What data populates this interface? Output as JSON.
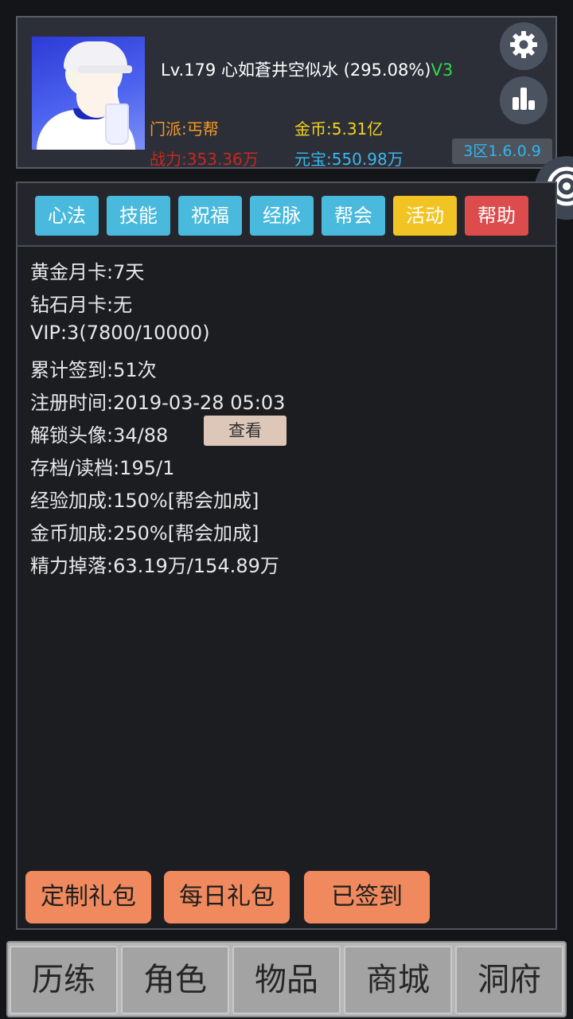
{
  "header": {
    "level_text": "Lv.179",
    "player_name": "心如蒼井空似水",
    "progress": "(295.08%)",
    "vip_tag": "V3",
    "sect": "门派:丐帮",
    "coins": "金币:5.31亿",
    "power": "战力:353.36万",
    "ingots": "元宝:550.98万",
    "version": "3区1.6.0.9",
    "icons": {
      "settings": "gear-icon",
      "stats": "bar-chart-icon",
      "side": "spiral-icon"
    }
  },
  "tabs": [
    {
      "label": "心法",
      "color": "#49b9dd"
    },
    {
      "label": "技能",
      "color": "#49b9dd"
    },
    {
      "label": "祝福",
      "color": "#49b9dd"
    },
    {
      "label": "经脉",
      "color": "#49b9dd"
    },
    {
      "label": "帮会",
      "color": "#49b9dd"
    },
    {
      "label": "活动",
      "color": "#f1c423"
    },
    {
      "label": "帮助",
      "color": "#dd4c4c"
    }
  ],
  "info": [
    "黄金月卡:7天",
    "钻石月卡:无",
    "VIP:3(7800/10000)",
    "累计签到:51次",
    "注册时间:2019-03-28 05:03",
    "解锁头像:34/88",
    "存档/读档:195/1",
    "经验加成:150%[帮会加成]",
    "金币加成:250%[帮会加成]",
    "精力掉落:63.19万/154.89万"
  ],
  "view_button": "查看",
  "gift_buttons": {
    "custom": "定制礼包",
    "daily": "每日礼包",
    "checked_in": "已签到"
  },
  "bottom_nav": [
    "历练",
    "角色",
    "物品",
    "商城",
    "洞府"
  ]
}
